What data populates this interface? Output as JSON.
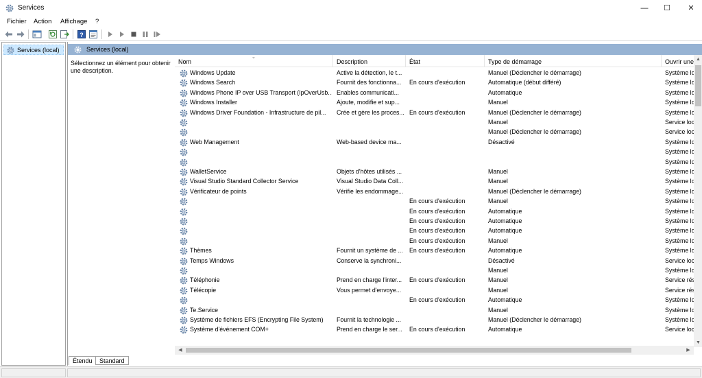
{
  "window": {
    "title": "Services",
    "controls": {
      "minimize": "—",
      "maximize": "☐",
      "close": "✕"
    }
  },
  "menu": [
    "Fichier",
    "Action",
    "Affichage",
    "?"
  ],
  "tree": {
    "root": "Services (local)"
  },
  "panel": {
    "header": "Services (local)",
    "description": "Sélectionnez un élément pour obtenir une description."
  },
  "columns": [
    "Nom",
    "Description",
    "État",
    "Type de démarrage",
    "Ouvrir une"
  ],
  "rows": [
    {
      "name": "Windows Update",
      "desc": "Active la détection, le t...",
      "state": "",
      "startup": "Manuel (Déclencher le démarrage)",
      "logon": "Système lo"
    },
    {
      "name": "Windows Search",
      "desc": "Fournit des fonctionna...",
      "state": "En cours d'exécution",
      "startup": "Automatique (début différé)",
      "logon": "Système lo"
    },
    {
      "name": "Windows Phone IP over USB Transport (IpOverUsb...",
      "desc": "Enables communicati...",
      "state": "",
      "startup": "Automatique",
      "logon": "Système lo"
    },
    {
      "name": "Windows Installer",
      "desc": "Ajoute, modifie et sup...",
      "state": "",
      "startup": "Manuel",
      "logon": "Système lo"
    },
    {
      "name": "Windows Driver Foundation - Infrastructure de pil...",
      "desc": "Crée et gère les proces...",
      "state": "En cours d'exécution",
      "startup": "Manuel (Déclencher le démarrage)",
      "logon": "Système lo"
    },
    {
      "name": "",
      "desc": "",
      "state": "",
      "startup": "Manuel",
      "logon": "Service loc"
    },
    {
      "name": "",
      "desc": "",
      "state": "",
      "startup": "Manuel (Déclencher le démarrage)",
      "logon": "Service loc"
    },
    {
      "name": "Web Management",
      "desc": "Web-based device ma...",
      "state": "",
      "startup": "Désactivé",
      "logon": "Système lo"
    },
    {
      "name": "",
      "desc": "",
      "state": "",
      "startup": "",
      "logon": "Système lo"
    },
    {
      "name": "",
      "desc": "",
      "state": "",
      "startup": "",
      "logon": "Système lo"
    },
    {
      "name": "WalletService",
      "desc": "Objets d'hôtes utilisés ...",
      "state": "",
      "startup": "Manuel",
      "logon": "Système lo"
    },
    {
      "name": "Visual Studio Standard Collector Service",
      "desc": "Visual Studio Data Coll...",
      "state": "",
      "startup": "Manuel",
      "logon": "Système lo"
    },
    {
      "name": "Vérificateur de points",
      "desc": "Vérifie les endommage...",
      "state": "",
      "startup": "Manuel (Déclencher le démarrage)",
      "logon": "Système lo"
    },
    {
      "name": "",
      "desc": "",
      "state": "En cours d'exécution",
      "startup": "Manuel",
      "logon": "Système lo"
    },
    {
      "name": "",
      "desc": "",
      "state": "En cours d'exécution",
      "startup": "Automatique",
      "logon": "Système lo"
    },
    {
      "name": "",
      "desc": "",
      "state": "En cours d'exécution",
      "startup": "Automatique",
      "logon": "Système lo"
    },
    {
      "name": "",
      "desc": "",
      "state": "En cours d'exécution",
      "startup": "Automatique",
      "logon": "Système lo"
    },
    {
      "name": "",
      "desc": "",
      "state": "En cours d'exécution",
      "startup": "Manuel",
      "logon": "Système lo"
    },
    {
      "name": "Thèmes",
      "desc": "Fournit un système de ...",
      "state": "En cours d'exécution",
      "startup": "Automatique",
      "logon": "Système lo"
    },
    {
      "name": "Temps Windows",
      "desc": "Conserve la synchroni...",
      "state": "",
      "startup": "Désactivé",
      "logon": "Service loc"
    },
    {
      "name": "",
      "desc": "",
      "state": "",
      "startup": "Manuel",
      "logon": "Système lo"
    },
    {
      "name": "Téléphonie",
      "desc": "Prend en charge l'inter...",
      "state": "En cours d'exécution",
      "startup": "Manuel",
      "logon": "Service rés"
    },
    {
      "name": "Télécopie",
      "desc": "Vous permet d'envoye...",
      "state": "",
      "startup": "Manuel",
      "logon": "Service rés"
    },
    {
      "name": "",
      "desc": "",
      "state": "En cours d'exécution",
      "startup": "Automatique",
      "logon": "Système lo"
    },
    {
      "name": "Te.Service",
      "desc": "",
      "state": "",
      "startup": "Manuel",
      "logon": "Système lo"
    },
    {
      "name": "Système de fichiers EFS (Encrypting File System)",
      "desc": "Fournit la technologie ...",
      "state": "",
      "startup": "Manuel (Déclencher le démarrage)",
      "logon": "Système lo"
    },
    {
      "name": "Système d'événement COM+",
      "desc": "Prend en charge le ser...",
      "state": "En cours d'exécution",
      "startup": "Automatique",
      "logon": "Service loc"
    }
  ],
  "tabs": [
    "Étendu",
    "Standard"
  ],
  "colors": {
    "selection": "#cce8ff",
    "panel_header": "#97b3d3",
    "gear": "#6a86a8"
  }
}
